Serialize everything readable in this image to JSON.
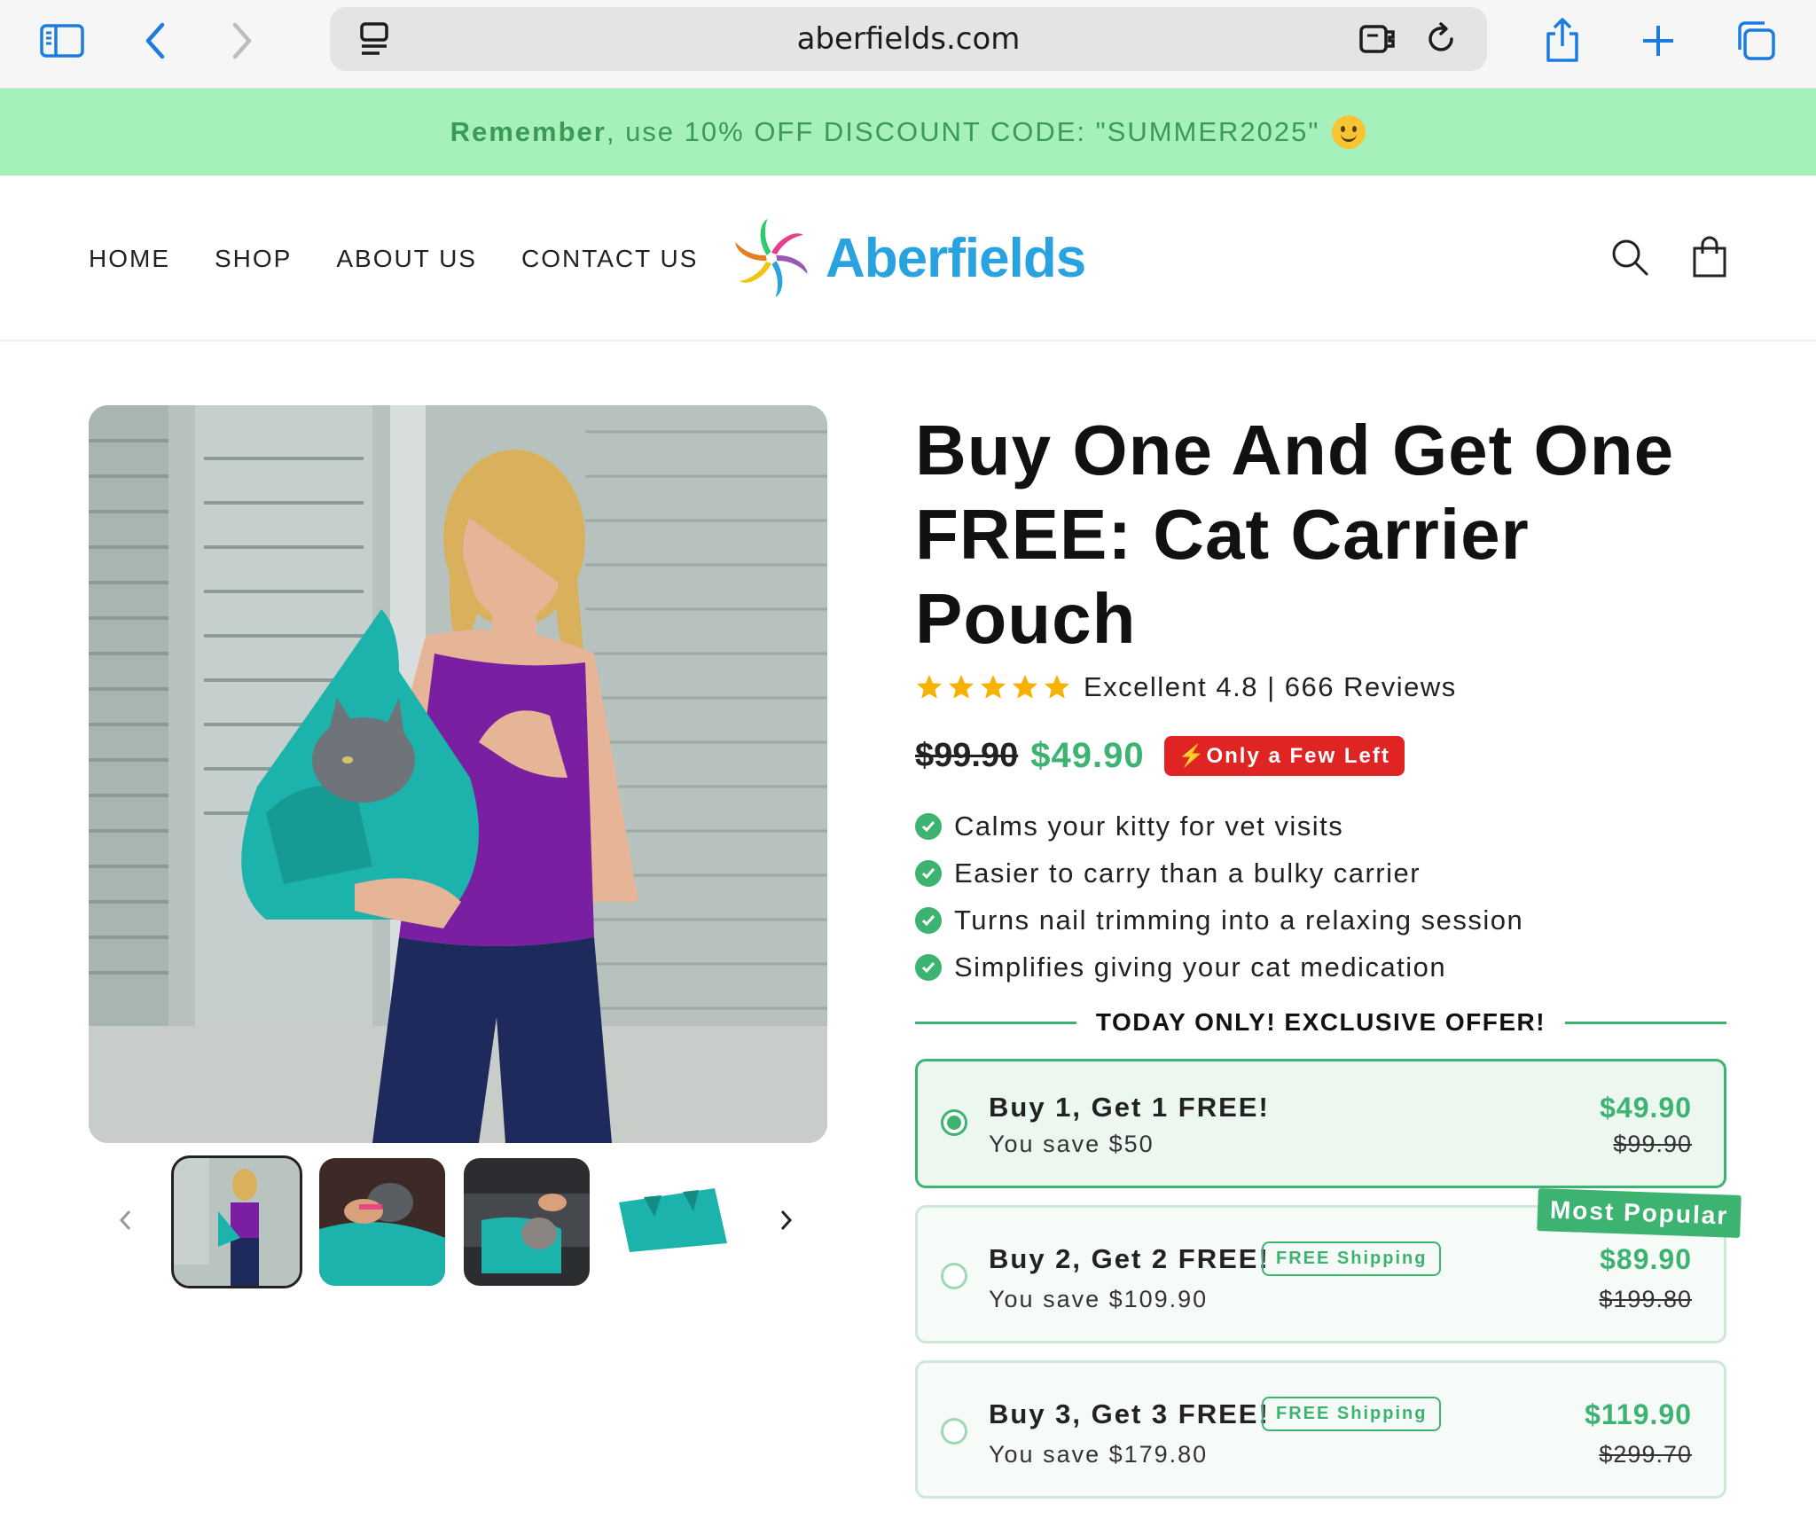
{
  "browser": {
    "url": "aberfields.com"
  },
  "announcement": {
    "bold": "Remember",
    "text": ", use 10% OFF DISCOUNT CODE: \"SUMMER2025\""
  },
  "nav": {
    "items": [
      "HOME",
      "SHOP",
      "ABOUT US",
      "CONTACT US"
    ]
  },
  "logo": {
    "name": "Aberfields"
  },
  "product": {
    "title": "Buy One And Get One FREE: Cat Carrier Pouch",
    "rating_text": "Excellent 4.8 | 666 Reviews",
    "rating_value": 4.8,
    "old_price": "$99.90",
    "price": "$49.90",
    "stock_badge": "Only a Few Left",
    "bullets": [
      "Calms your kitty for vet visits",
      "Easier to carry than a bulky carrier",
      "Turns nail trimming into a relaxing session",
      "Simplifies giving your cat medication"
    ]
  },
  "offer": {
    "heading": "TODAY ONLY! EXCLUSIVE OFFER!",
    "popular_label": "Most Popular",
    "options": [
      {
        "title": "Buy 1, Get 1 FREE!",
        "save": "You save $50",
        "price": "$49.90",
        "compare": "$99.90",
        "badge": "",
        "selected": true
      },
      {
        "title": "Buy 2, Get 2 FREE!",
        "save": "You save $109.90",
        "price": "$89.90",
        "compare": "$199.80",
        "badge": "FREE Shipping",
        "selected": false
      },
      {
        "title": "Buy 3, Get 3 FREE!",
        "save": "You save $179.80",
        "price": "$119.90",
        "compare": "$299.70",
        "badge": "FREE Shipping",
        "selected": false
      }
    ]
  },
  "colors": {
    "accent_green": "#3cb371",
    "banner_green": "#a5f0bb",
    "logo_blue": "#29a3e0",
    "badge_red": "#e02424"
  },
  "icons": {
    "sidebar": "sidebar-icon",
    "back": "chevron-left-icon",
    "forward": "chevron-right-icon",
    "share": "share-icon",
    "new_tab": "plus-icon",
    "tabs": "tabs-icon",
    "search": "search-icon",
    "cart": "bag-icon"
  }
}
